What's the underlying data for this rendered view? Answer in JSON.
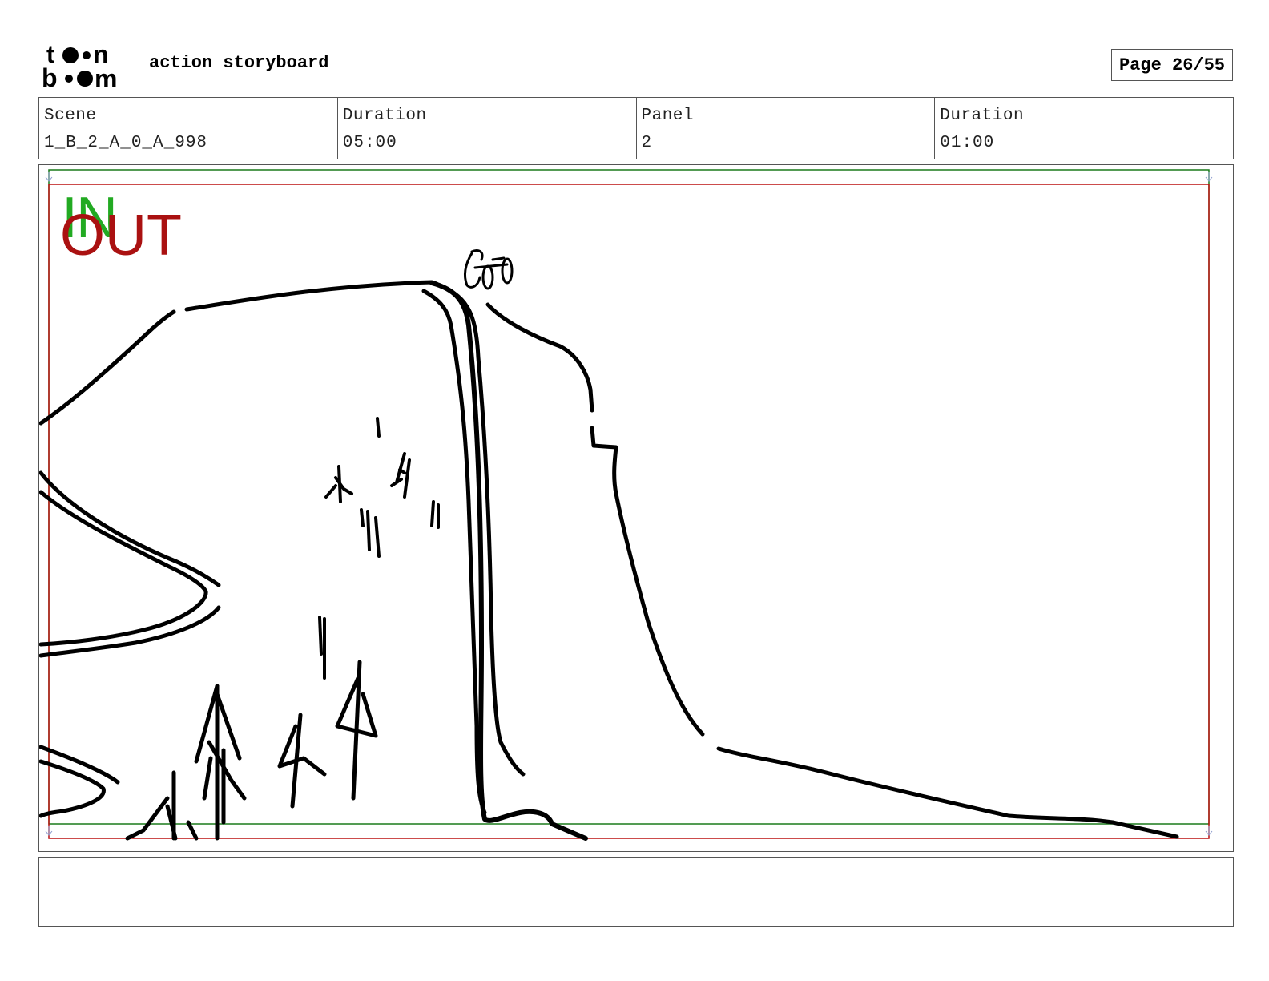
{
  "header": {
    "logo_text_top": "toon",
    "logo_text_bottom": "boom",
    "title": "action storyboard",
    "page_label": "Page 26/55"
  },
  "info": {
    "scene_label": "Scene",
    "scene_value": "1_B_2_A_0_A_998",
    "scene_duration_label": "Duration",
    "scene_duration_value": "05:00",
    "panel_label": "Panel",
    "panel_value": "2",
    "panel_duration_label": "Duration",
    "panel_duration_value": "01:00"
  },
  "panel": {
    "in_marker": "IN",
    "out_marker": "OUT",
    "in_color": "#22aa22",
    "out_color": "#aa1111"
  },
  "notes": {
    "text": ""
  }
}
